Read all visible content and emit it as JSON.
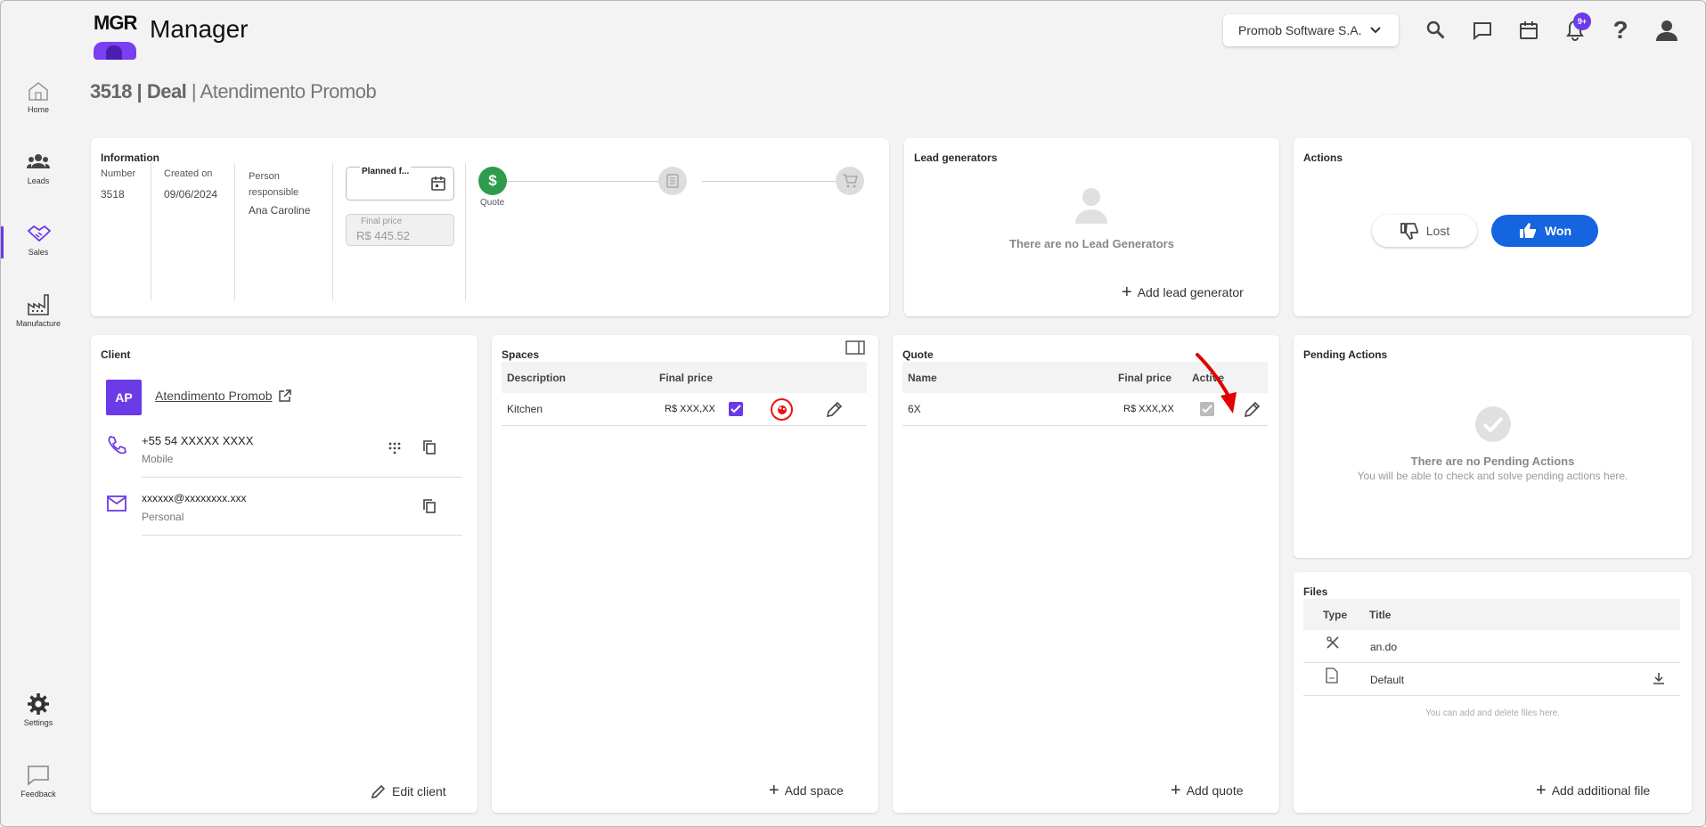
{
  "app": {
    "logo_text": "MGR",
    "title": "Manager"
  },
  "header": {
    "company": "Promob Software S.A.",
    "notification_count": "9+"
  },
  "sidebar": {
    "items": [
      {
        "label": "Home",
        "icon": "home-icon"
      },
      {
        "label": "Leads",
        "icon": "people-icon"
      },
      {
        "label": "Sales",
        "icon": "handshake-icon"
      },
      {
        "label": "Manufacture",
        "icon": "factory-icon"
      },
      {
        "label": "Settings",
        "icon": "gear-icon"
      },
      {
        "label": "Feedback",
        "icon": "feedback-icon"
      }
    ]
  },
  "page": {
    "title_bold": "3518 | Deal",
    "title_sep": " | ",
    "title_rest": "Atendimento Promob"
  },
  "information": {
    "title": "Information",
    "number_label": "Number",
    "number": "3518",
    "created_label": "Created on",
    "created": "09/06/2024",
    "person_label": "Person responsible",
    "person": "Ana Caroline",
    "planned_label": "Planned f...",
    "final_price_label": "Final price",
    "final_price": "R$ 445.52",
    "stage_label": "Quote"
  },
  "lead_generators": {
    "title": "Lead generators",
    "empty": "There are no Lead Generators",
    "add": "Add lead generator"
  },
  "actions": {
    "title": "Actions",
    "lost": "Lost",
    "won": "Won"
  },
  "client": {
    "title": "Client",
    "initials": "AP",
    "name": "Atendimento Promob",
    "phone": "+55 54 XXXXX XXXX",
    "phone_type": "Mobile",
    "email": "xxxxxx@xxxxxxxx.xxx",
    "email_type": "Personal",
    "edit": "Edit client"
  },
  "spaces": {
    "title": "Spaces",
    "columns": [
      "Description",
      "Final price"
    ],
    "rows": [
      {
        "description": "Kitchen",
        "price": "R$ XXX,XX",
        "checked": true
      }
    ],
    "add": "Add space"
  },
  "quote": {
    "title": "Quote",
    "columns": [
      "Name",
      "Final price",
      "Active"
    ],
    "rows": [
      {
        "name": "6X",
        "price": "R$ XXX,XX",
        "active": true
      }
    ],
    "add": "Add quote"
  },
  "pending": {
    "title": "Pending Actions",
    "empty": "There are no Pending Actions",
    "sub": "You will be able to check and solve pending actions here."
  },
  "files": {
    "title": "Files",
    "columns": [
      "Type",
      "Title"
    ],
    "rows": [
      {
        "title": "an.do",
        "icon": "tools-icon"
      },
      {
        "title": "Default",
        "icon": "pdf-icon"
      }
    ],
    "hint": "You can add and delete files here.",
    "add": "Add additional file"
  },
  "colors": {
    "accent": "#6b3be8",
    "won": "#1565e0",
    "success": "#2e9c4a",
    "annotation": "#e00000"
  }
}
